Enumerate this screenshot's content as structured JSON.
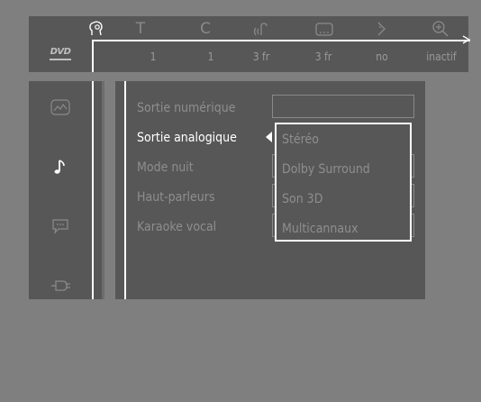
{
  "topbar": {
    "icons": [
      {
        "name": "user-head-icon"
      },
      {
        "name": "title-icon",
        "glyph": "T"
      },
      {
        "name": "chapter-icon",
        "glyph": "C"
      },
      {
        "name": "audio-icon"
      },
      {
        "name": "subtitle-icon"
      },
      {
        "name": "angle-icon"
      },
      {
        "name": "zoom-icon"
      }
    ],
    "disc_logo": "DVD",
    "values": [
      "1",
      "1",
      "3 fr",
      "3 fr",
      "no",
      "inactif"
    ]
  },
  "side_icons": [
    "picture-icon",
    "music-note-icon",
    "speech-bubble-icon",
    "plug-icon"
  ],
  "menu": {
    "items": [
      "Sortie numérique",
      "Sortie analogique",
      "Mode nuit",
      "Haut-parleurs",
      "Karaoke vocal"
    ],
    "active_index": 1
  },
  "dropdown": {
    "options": [
      "Stéréo",
      "Dolby Surround",
      "Son 3D",
      "Multicannaux"
    ]
  },
  "colors": {
    "background": "#7f7f7f",
    "panel": "#575757",
    "active_text": "#ffffff",
    "inactive_text": "#8e8e8e"
  }
}
